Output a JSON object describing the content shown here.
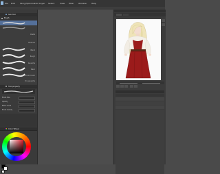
{
  "menubar": {
    "items": [
      "File",
      "Edit",
      "Story(S)",
      "Animation",
      "Layer",
      "Select",
      "View",
      "Filter",
      "Window",
      "Help"
    ]
  },
  "brush_panel": {
    "title": "Sub Tool",
    "tab": "Brush",
    "items": [
      "",
      "Pastel",
      "Textured",
      "Blend",
      "Rough",
      "Gouache",
      "Wash",
      "Watercolor brush",
      "Dry gouache"
    ],
    "selected_index": 0
  },
  "tool_property": {
    "title": "Tool property",
    "rows": [
      {
        "label": "Brush Size",
        "value": ""
      },
      {
        "label": "Opacity",
        "value": ""
      },
      {
        "label": "Blend mode",
        "value": ""
      },
      {
        "label": "Brush density",
        "value": ""
      }
    ]
  },
  "color_panel": {
    "title": "Color Wheel",
    "main_color": "#000000",
    "sub_color": "#ffffff"
  },
  "layer_panel": {
    "rows": [
      "",
      "",
      ""
    ]
  },
  "colors": {
    "menubar_bg": "#353535",
    "panel_bg": "#3a3a3a",
    "canvas_bg": "#4d4d4d",
    "accent": "#54709a",
    "dress_red": "#9b1b1b",
    "blouse_white": "#f4f0e8",
    "hair_blonde": "#efe4b8"
  }
}
